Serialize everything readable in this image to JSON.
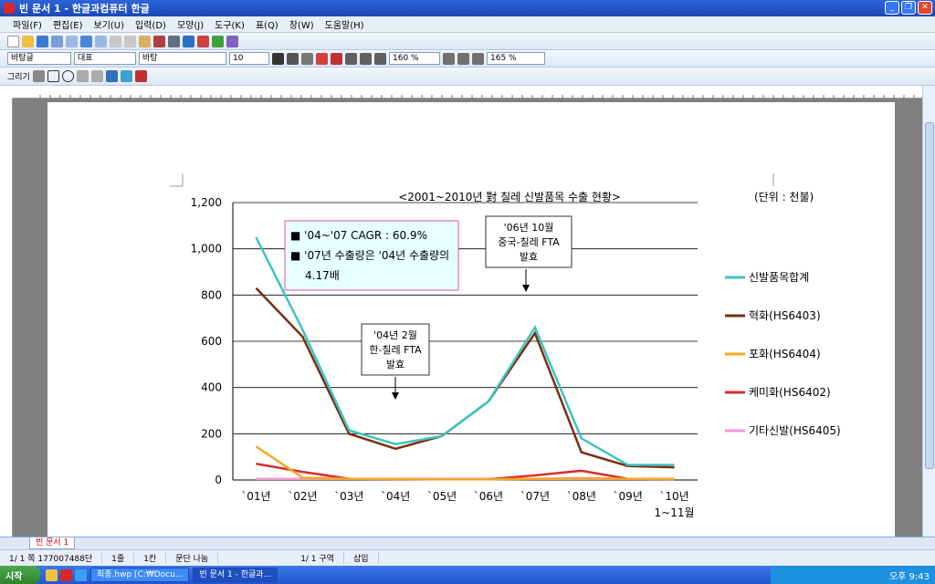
{
  "window": {
    "title": "빈 문서 1 - 한글과컴퓨터 한글"
  },
  "menu": [
    "파일(F)",
    "편집(E)",
    "보기(U)",
    "입력(D)",
    "모양(J)",
    "도구(K)",
    "표(Q)",
    "창(W)",
    "도움말(H)"
  ],
  "format_bar": {
    "style": "바탕글",
    "lang": "대표",
    "font": "바탕",
    "size": "10",
    "line_spacing": "160 %",
    "zoom": "165 %"
  },
  "draw_bar": {
    "label": "그리기"
  },
  "chart_data": {
    "type": "line",
    "title": "<2001~2010년 對 칠레 신발품목 수출 현황>",
    "unit_label": "(단위 : 천불)",
    "categories": [
      "`01년",
      "`02년",
      "`03년",
      "`04년",
      "`05년",
      "`06년",
      "`07년",
      "`08년",
      "`09년",
      "`10년"
    ],
    "category_note": "1~11월",
    "ylim": [
      0,
      1200
    ],
    "yticks": [
      "0",
      "200",
      "400",
      "600",
      "800",
      "1,000",
      "1,200"
    ],
    "series": [
      {
        "name": "신발품목합계",
        "color": "#3cc3c3",
        "values": [
          1050,
          650,
          215,
          155,
          190,
          340,
          660,
          180,
          65,
          65
        ]
      },
      {
        "name": "혁화(HS6403)",
        "color": "#7b2e0e",
        "values": [
          830,
          620,
          200,
          135,
          190,
          340,
          635,
          120,
          60,
          55
        ]
      },
      {
        "name": "포화(HS6404)",
        "color": "#f5a623",
        "values": [
          145,
          10,
          5,
          5,
          3,
          3,
          5,
          8,
          5,
          5
        ]
      },
      {
        "name": "케미화(HS6402)",
        "color": "#d92b2b",
        "values": [
          70,
          35,
          5,
          3,
          3,
          3,
          20,
          40,
          5,
          3
        ]
      },
      {
        "name": "기타신발(HS6405)",
        "color": "#f29bd0",
        "values": [
          5,
          5,
          5,
          5,
          5,
          5,
          5,
          5,
          5,
          5
        ]
      }
    ],
    "info_box": {
      "line1": "■ '04~'07 CAGR : 60.9%",
      "line2": "■ '07년 수출량은 '04년 수출량의",
      "line3": "4.17배"
    },
    "callouts": [
      {
        "lines": [
          "'04년 2월",
          "한-칠레 FTA",
          "발효"
        ]
      },
      {
        "lines": [
          "'06년 10월",
          "중국-칠레 FTA",
          "발효"
        ]
      }
    ]
  },
  "tabs": [
    "빈 문서 1"
  ],
  "status": {
    "page": "1/ 1 쪽 177007488단",
    "line": "1줄",
    "col": "1칸",
    "break": "문단 나눔",
    "section": "1/ 1 구역",
    "mode": "삽입"
  },
  "taskbar": {
    "start": "시작",
    "tasks": [
      "최종.hwp [C:₩Docu...",
      "빈 문서 1 - 한글과..."
    ],
    "clock": "오후 9:43"
  }
}
